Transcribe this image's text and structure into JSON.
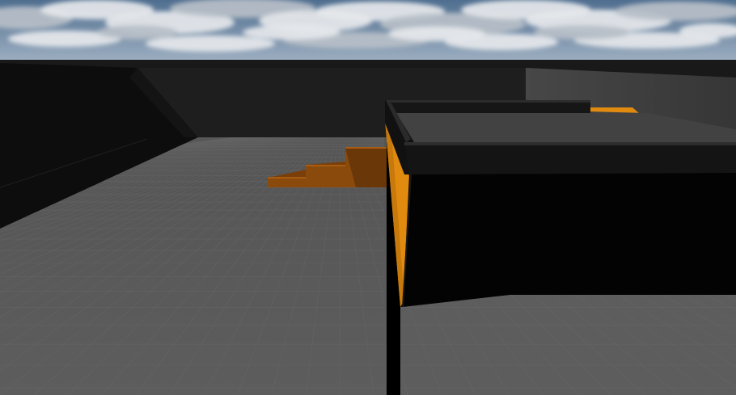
{
  "scene": {
    "colors": {
      "sky_top": "#4f6e8f",
      "sky_mid": "#9fb0c2",
      "cloud": "#e6e8eb",
      "cloud_shadow": "#b7bfc8",
      "wall_back": "#191919",
      "wall_left": "#0d0d0d",
      "wall_right": "#3d3d3d",
      "floor": "#5d5d5d",
      "floor_far": "#555555",
      "grid_line": "#6c6c6c",
      "stairs": "#8a4a0c",
      "stairs_dark": "#6a3708",
      "accent_orange": "#e08a10",
      "block_top": "#424242",
      "block_front": "#030303",
      "rim_dark": "#161616",
      "rim_top": "#2c2c2c"
    }
  }
}
